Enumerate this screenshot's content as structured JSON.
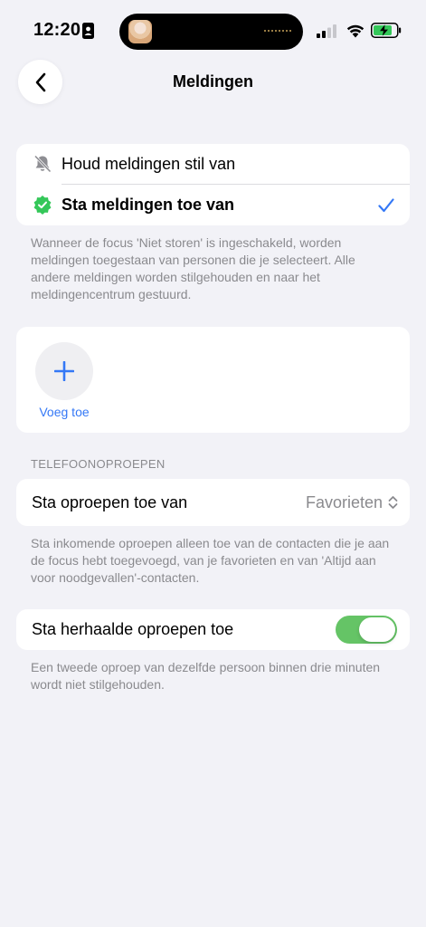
{
  "status_bar": {
    "time": "12:20",
    "icons": [
      "contact-card-icon",
      "cellular-signal-icon",
      "wifi-icon",
      "battery-charging-icon"
    ]
  },
  "nav": {
    "title": "Meldingen",
    "back_icon": "chevron-left-icon"
  },
  "mode_options": [
    {
      "label": "Houd meldingen stil van",
      "icon": "bell-slash-icon",
      "selected": false
    },
    {
      "label": "Sta meldingen toe van",
      "icon": "checkmark-badge-icon",
      "selected": true
    }
  ],
  "mode_footnote": "Wanneer de focus 'Niet storen' is ingeschakeld, worden meldingen toegestaan van personen die je selecteert. Alle andere meldingen worden stilgehouden en naar het meldingencentrum gestuurd.",
  "people": {
    "add_label": "Voeg toe"
  },
  "calls_section": {
    "header": "TELEFOONOPROEPEN",
    "allow_calls_label": "Sta oproepen toe van",
    "allow_calls_value": "Favorieten",
    "allow_calls_footnote": "Sta inkomende oproepen alleen toe van de contacten die je aan de focus hebt toegevoegd, van je favorieten en van 'Altijd aan voor noodgevallen'-contacten.",
    "repeated_calls_label": "Sta herhaalde oproepen toe",
    "repeated_calls_on": true,
    "repeated_calls_footnote": "Een tweede oproep van dezelfde persoon binnen drie minuten wordt niet stilgehouden."
  },
  "colors": {
    "accent": "#3478f6",
    "toggle_on": "#65c466",
    "badge_green": "#34c759",
    "secondary_text": "#8a8a8e",
    "background": "#f2f2f7"
  }
}
